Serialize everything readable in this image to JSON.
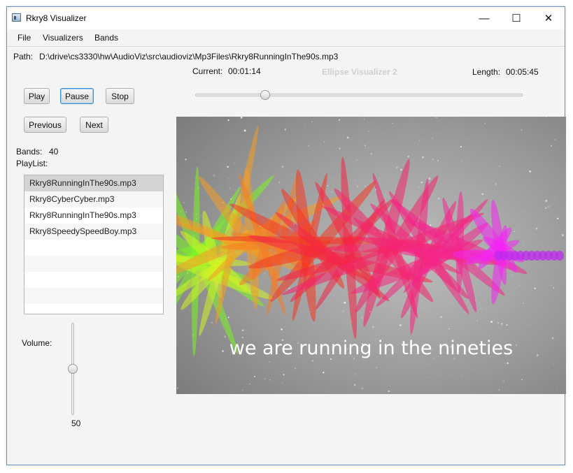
{
  "window": {
    "title": "Rkry8 Visualizer",
    "minimize_glyph": "—",
    "maximize_glyph": "☐",
    "close_glyph": "✕"
  },
  "menu": [
    "File",
    "Visualizers",
    "Bands"
  ],
  "path": {
    "label": "Path:",
    "value": "D:\\drive\\cs3330\\hw\\AudioViz\\src\\audioviz\\Mp3Files\\Rkry8RunningInThe90s.mp3"
  },
  "current": {
    "label": "Current:",
    "value": "00:01:14"
  },
  "length": {
    "label": "Length:",
    "value": "00:05:45"
  },
  "visualizer_name": "Ellipse Visualizer 2",
  "controls": {
    "play": "Play",
    "pause": "Pause",
    "stop": "Stop",
    "previous": "Previous",
    "next": "Next"
  },
  "progress_fraction": 0.214,
  "bands": {
    "label": "Bands:",
    "value": "40"
  },
  "playlist": {
    "label": "PlayList:",
    "items": [
      "Rkry8RunningInThe90s.mp3",
      "Rkry8CyberCyber.mp3",
      "Rkry8RunningInThe90s.mp3",
      "Rkry8SpeedySpeedBoy.mp3"
    ],
    "selected_index": 0
  },
  "volume": {
    "label": "Volume:",
    "value": "50",
    "fraction": 0.5
  },
  "lyric": "we are running in the nineties",
  "colors": {
    "accent": "#3c8ed6",
    "visualizer_background": "#8d8d8d"
  }
}
